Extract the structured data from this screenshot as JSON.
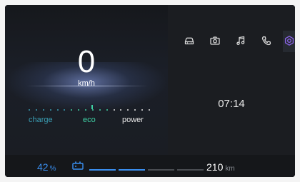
{
  "speedometer": {
    "value": "0",
    "unit": "km/h"
  },
  "drive_modes": {
    "charge": "charge",
    "eco": "eco",
    "power": "power"
  },
  "top_nav": {
    "items": [
      {
        "icon": "car-icon"
      },
      {
        "icon": "camera-icon"
      },
      {
        "icon": "music-icon"
      },
      {
        "icon": "phone-icon"
      },
      {
        "icon": "settings-icon",
        "active": true
      }
    ]
  },
  "clock": {
    "time": "07:14"
  },
  "status": {
    "battery_value": "42",
    "battery_unit": "%",
    "battery_level": 0.42,
    "range_value": "210",
    "range_unit": "km"
  },
  "colors": {
    "accent_blue": "#3a8ff0",
    "eco_green": "#3fd1a5",
    "charge_teal": "#3a9fb5",
    "active_icon": "#8a63e8"
  }
}
